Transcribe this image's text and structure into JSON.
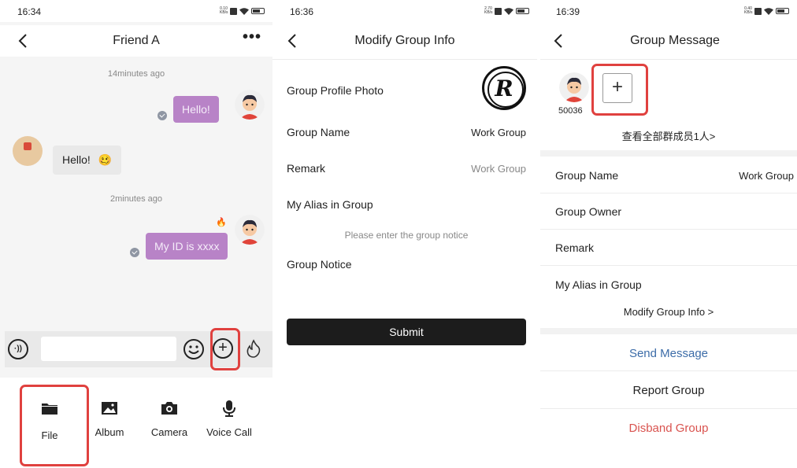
{
  "screen1": {
    "status": {
      "time": "16:34",
      "speed": "0.10 KB/s"
    },
    "nav": {
      "title": "Friend A",
      "more": "•••"
    },
    "messages": {
      "ts1": "14minutes ago",
      "me1": "Hello!",
      "friend1": "Hello!",
      "friend1_emoji": "🥴",
      "ts2": "2minutes ago",
      "me2": "My ID is xxxx"
    },
    "input": {
      "value": "",
      "placeholder": ""
    },
    "tools": [
      {
        "label": "File",
        "icon": "folder-icon"
      },
      {
        "label": "Album",
        "icon": "image-icon"
      },
      {
        "label": "Camera",
        "icon": "camera-icon"
      },
      {
        "label": "Voice Call",
        "icon": "microphone-icon"
      }
    ]
  },
  "screen2": {
    "status": {
      "time": "16:36",
      "speed": "2.70 KB/s"
    },
    "nav": {
      "title": "Modify Group Info"
    },
    "rows": {
      "photo_label": "Group Profile Photo",
      "name_label": "Group Name",
      "name_value": "Work Group",
      "remark_label": "Remark",
      "remark_value": "Work Group",
      "alias_label": "My Alias in Group",
      "notice_label": "Group Notice"
    },
    "notice_placeholder": "Please enter the group notice",
    "logo_letter": "R",
    "submit": "Submit"
  },
  "screen3": {
    "status": {
      "time": "16:39",
      "speed": "0.40 KB/s"
    },
    "nav": {
      "title": "Group Message"
    },
    "member": {
      "id": "50036"
    },
    "add_symbol": "+",
    "view_all": "查看全部群成员1人>",
    "rows": {
      "name_label": "Group Name",
      "name_value": "Work Group",
      "owner_label": "Group Owner",
      "remark_label": "Remark",
      "alias_label": "My Alias in Group"
    },
    "modify_link": "Modify Group Info >",
    "actions": {
      "send": "Send Message",
      "report": "Report Group",
      "disband": "Disband Group"
    },
    "colors": {
      "send": "#3c6ca8",
      "disband": "#d9534f"
    }
  },
  "colors": {
    "bubble_me": "#b883c7",
    "highlight": "#e0413f"
  }
}
